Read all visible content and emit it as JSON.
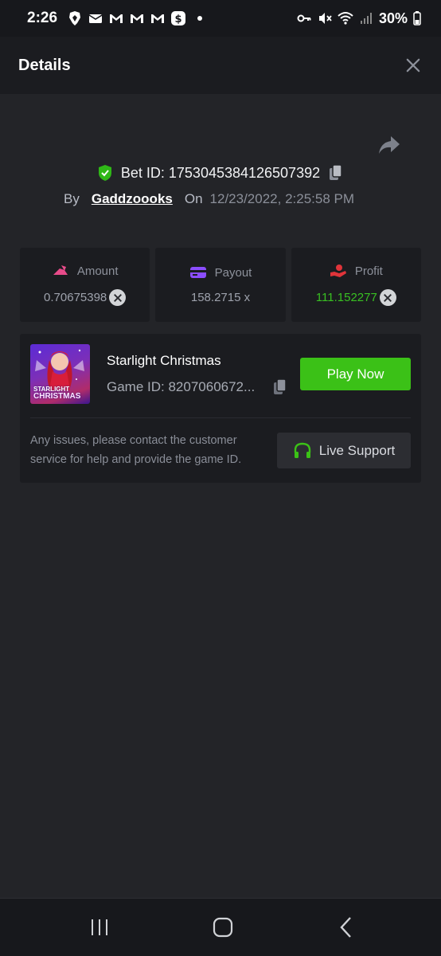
{
  "status_bar": {
    "time": "2:26",
    "battery": "30%",
    "left_icons": [
      "brave-icon",
      "mail-icon",
      "gmail-icon",
      "gmail-icon",
      "gmail-icon",
      "cash-app-icon",
      "notification-dot"
    ],
    "right_icons": [
      "key-icon",
      "mute-icon",
      "wifi-icon",
      "signal-icon",
      "battery-icon"
    ]
  },
  "header": {
    "title": "Details"
  },
  "bet": {
    "id_label": "Bet ID: 1753045384126507392",
    "by_label": "By",
    "user": "Gaddzoooks",
    "on_label": "On",
    "date": "12/23/2022, 2:25:58 PM"
  },
  "stats": {
    "amount": {
      "label": "Amount",
      "value": "0.70675398",
      "icon_color": "#e84b8a"
    },
    "payout": {
      "label": "Payout",
      "value": "158.2715 x",
      "icon_color": "#8b4dff"
    },
    "profit": {
      "label": "Profit",
      "value": "111.152277",
      "icon_color": "#e0343a",
      "value_color": "#39c022"
    }
  },
  "game": {
    "name": "Starlight Christmas",
    "id_text": "Game ID: 8207060672...",
    "thumb_line1": "STARLIGHT",
    "thumb_line2": "CHRISTMAS",
    "play_label": "Play Now",
    "help_text": "Any issues, please contact the customer service for help and provide the game ID.",
    "support_label": "Live Support"
  },
  "colors": {
    "accent_green": "#3bc117",
    "background": "#232428",
    "panel": "#1b1c20"
  }
}
